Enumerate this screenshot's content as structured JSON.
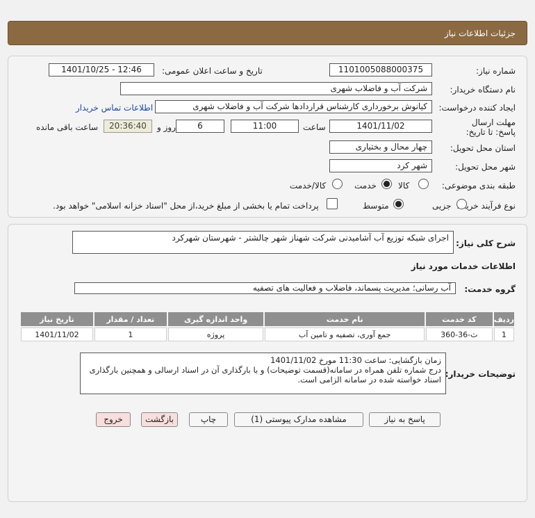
{
  "header": {
    "title": "جزئیات اطلاعات نیاز"
  },
  "form": {
    "need_number_label": "شماره نیاز:",
    "need_number": "1101005088000375",
    "announce_label": "تاریخ و ساعت اعلان عمومی:",
    "announce_value": "1401/10/25 - 12:46",
    "buyer_org_label": "نام دستگاه خریدار:",
    "buyer_org": "شرکت آب و فاضلاب شهری",
    "requester_label": "ایجاد کننده درخواست:",
    "requester": "کیانوش برخورداری کارشناس قراردادها شرکت آب و فاضلاب شهری",
    "contact_link": "اطلاعات تماس خریدار",
    "deadline_label": "مهلت ارسال پاسخ: تا تاریخ:",
    "deadline_date": "1401/11/02",
    "time_label": "ساعت",
    "deadline_time": "11:00",
    "days_value": "6",
    "days_label": "روز و",
    "remaining_time": "20:36:40",
    "remaining_label": "ساعت باقی مانده",
    "province_label": "استان محل تحویل:",
    "province": "چهار محال و بختیاری",
    "city_label": "شهر محل تحویل:",
    "city": "شهر کرد",
    "category_label": "طبقه بندی موضوعی:",
    "category_options": [
      "کالا",
      "خدمت",
      "کالا/خدمت"
    ],
    "category_selected": "خدمت",
    "process_label": "نوع فرآیند خرید :",
    "process_options": [
      "جزیی",
      "متوسط"
    ],
    "process_selected": "متوسط",
    "payment_note": "پرداخت تمام یا بخشی از مبلغ خرید،از محل \"اسناد خزانه اسلامی\" خواهد بود."
  },
  "summary": {
    "label": "شرح کلی نیاز:",
    "text": "اجرای شبکه توزیع آب آشامیدنی شرکت شهناز شهر چالشتر - شهرستان شهرکرد",
    "services_title": "اطلاعات خدمات مورد نیاز",
    "service_group_label": "گروه خدمت:",
    "service_group": "آب رسانی؛ مدیریت پسماند، فاضلاب و فعالیت های تصفیه"
  },
  "table": {
    "headers": [
      "ردیف",
      "کد خدمت",
      "نام خدمت",
      "واحد اندازه گیری",
      "تعداد / مقدار",
      "تاریخ نیاز"
    ],
    "rows": [
      [
        "1",
        "ث-36-360",
        "جمع آوری، تصفیه و تامین آب",
        "پروژه",
        "1",
        "1401/11/02"
      ]
    ]
  },
  "buyer_notes": {
    "label": "توضیحات خریدار:",
    "line1": "زمان بازگشایی: ساعت 11:30 مورخ 1401/11/02",
    "line2": "درج شماره تلفن همراه در سامانه(قسمت توضیحات) و با بارگذاری آن در اسناد ارسالی و همچنین بارگذاری اسناد خواسته شده در سامانه الزامی است."
  },
  "buttons": {
    "reply": "پاسخ به نیاز",
    "attachments": "مشاهده مدارک پیوستی (1)",
    "print": "چاپ",
    "back": "بازگشت",
    "exit": "خروج"
  },
  "colors": {
    "header_bg": "#8b6a43",
    "table_header_bg": "#8f8f8f",
    "link": "#1a4aa0"
  }
}
